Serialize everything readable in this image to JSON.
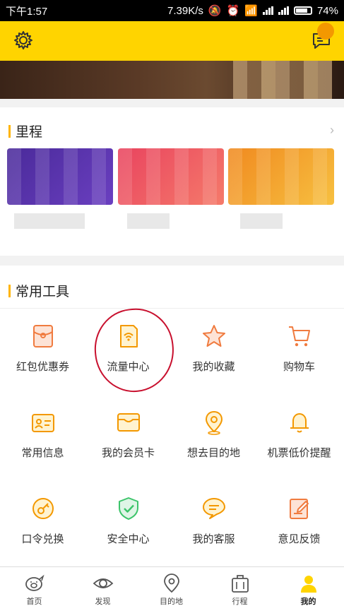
{
  "status_bar": {
    "time": "下午1:57",
    "speed": "7.39K/s",
    "battery": "74%"
  },
  "featured": {
    "title": "里程"
  },
  "tools_section": {
    "title": "常用工具",
    "items": [
      {
        "label": "红包优惠券",
        "icon": "coupon-icon"
      },
      {
        "label": "流量中心",
        "icon": "sim-card-icon"
      },
      {
        "label": "我的收藏",
        "icon": "star-icon"
      },
      {
        "label": "购物车",
        "icon": "cart-icon"
      },
      {
        "label": "常用信息",
        "icon": "id-card-icon"
      },
      {
        "label": "我的会员卡",
        "icon": "wallet-icon"
      },
      {
        "label": "想去目的地",
        "icon": "location-pin-icon"
      },
      {
        "label": "机票低价提醒",
        "icon": "bell-icon"
      },
      {
        "label": "口令兑换",
        "icon": "key-icon"
      },
      {
        "label": "安全中心",
        "icon": "shield-icon"
      },
      {
        "label": "我的客服",
        "icon": "chat-bubble-icon"
      },
      {
        "label": "意见反馈",
        "icon": "feedback-icon"
      }
    ]
  },
  "tab_bar": {
    "items": [
      {
        "label": "首页",
        "icon": "pig-icon"
      },
      {
        "label": "发现",
        "icon": "eye-icon"
      },
      {
        "label": "目的地",
        "icon": "map-pin-icon"
      },
      {
        "label": "行程",
        "icon": "suitcase-icon"
      },
      {
        "label": "我的",
        "icon": "profile-icon"
      }
    ],
    "active": "我的"
  },
  "colors": {
    "brand_yellow": "#ffd400",
    "accent_orange": "#f39800",
    "icon_orange": "#f07b3f",
    "icon_green": "#3cc46a",
    "annotation_red": "#c8102e"
  }
}
